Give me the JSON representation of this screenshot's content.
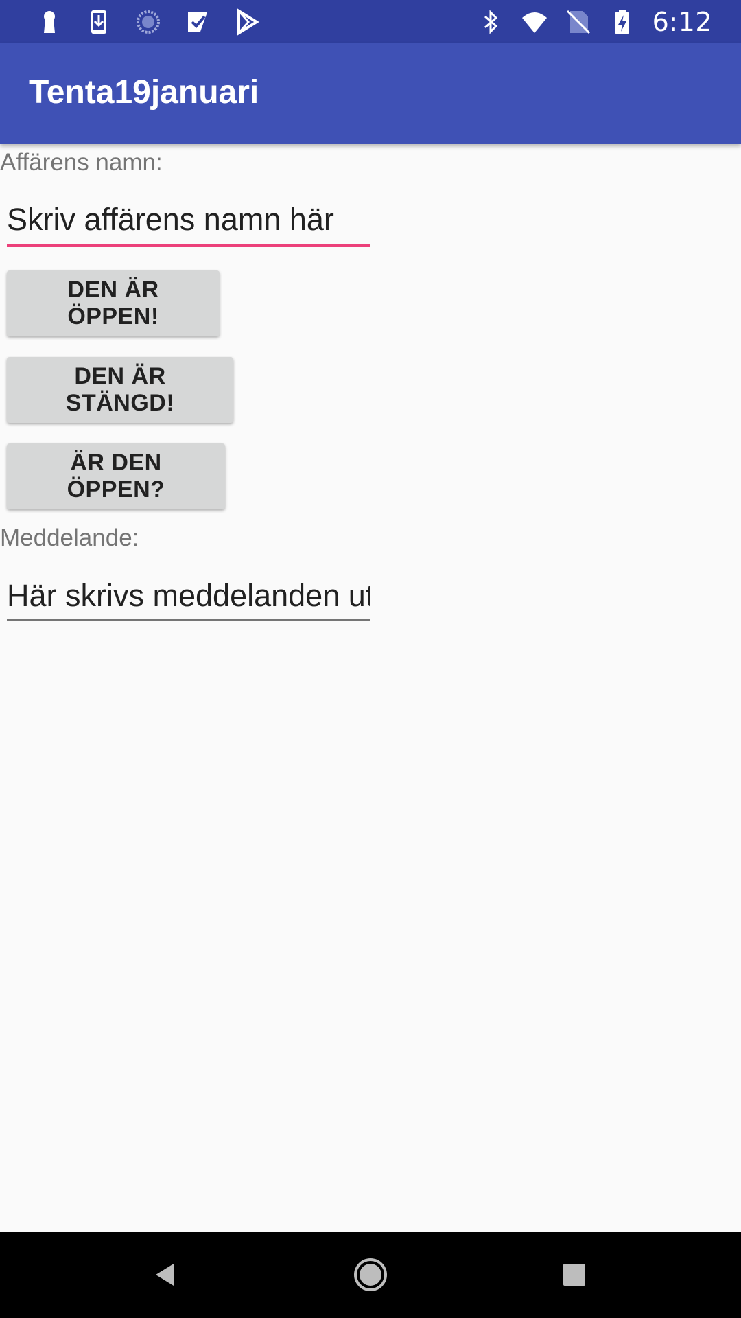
{
  "status_bar": {
    "time": "6:12",
    "left_icons": [
      "keyhole-icon",
      "download-icon",
      "sync-icon",
      "store-icon",
      "play-store-icon"
    ],
    "right_icons": [
      "bluetooth-icon",
      "wifi-icon",
      "no-sim-icon",
      "battery-charging-icon"
    ],
    "color": "#303F9F"
  },
  "app_bar": {
    "title": "Tenta19januari",
    "color": "#3F51B5"
  },
  "form": {
    "name_label": "Affärens namn:",
    "name_value": "Skriv affärens namn här",
    "btn_open": "DEN ÄR ÖPPEN!",
    "btn_closed": "DEN ÄR STÄNGD!",
    "btn_ask": "ÄR DEN ÖPPEN?",
    "message_label": "Meddelande:",
    "message_value": "Här skrivs meddelanden ut",
    "accent_color": "#E91E63"
  },
  "nav_bar": {
    "icons": [
      "back-icon",
      "home-icon",
      "recents-icon"
    ]
  }
}
